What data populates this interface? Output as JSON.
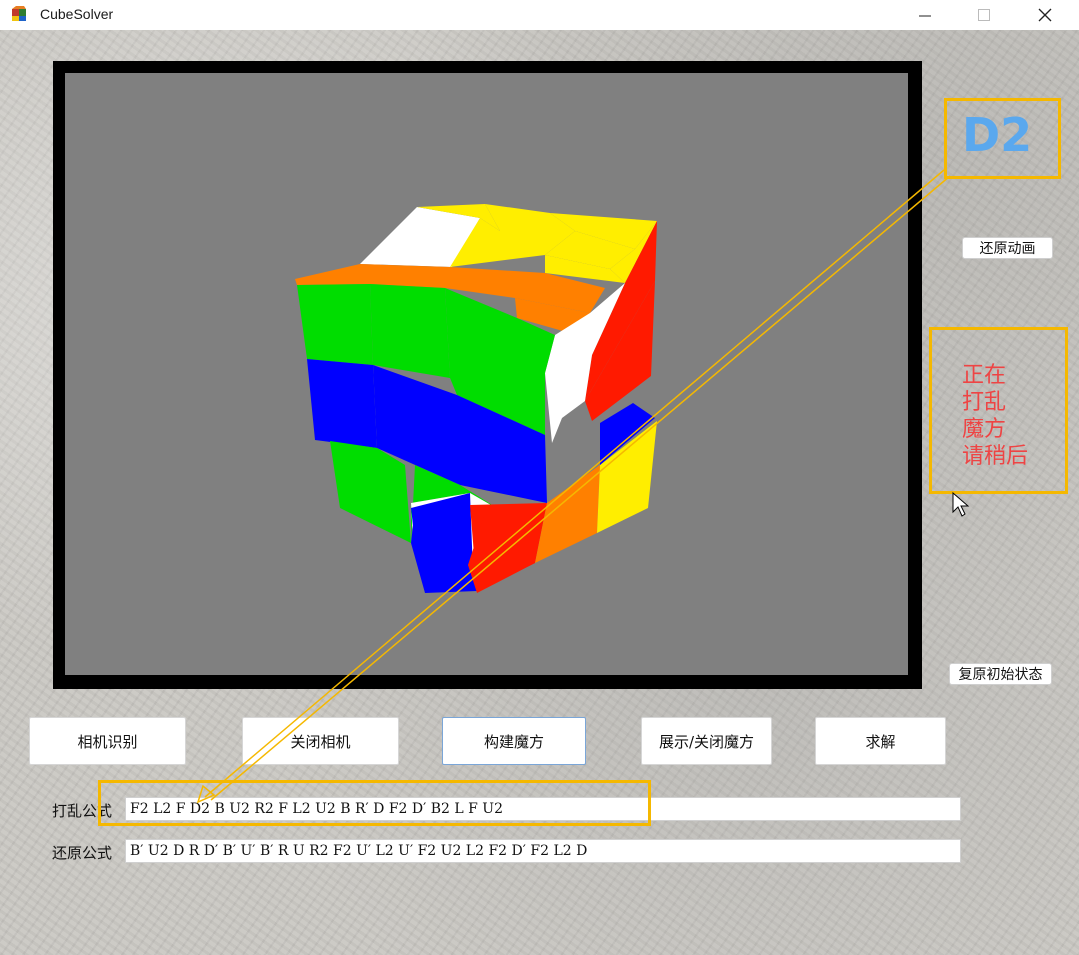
{
  "window": {
    "title": "CubeSolver",
    "controls": [
      "minimize-icon",
      "maximize-icon",
      "close-icon"
    ]
  },
  "side": {
    "current_move": "D2",
    "status_lines": [
      "正在",
      "打乱",
      "魔方",
      "请稍后"
    ],
    "animate_button": "还原动画",
    "reset_button": "复原初始状态"
  },
  "toolbar": {
    "camera_recognize": "相机识别",
    "close_camera": "关闭相机",
    "build_cube": "构建魔方",
    "toggle_cube": "展示/关闭魔方",
    "solve": "求解"
  },
  "formulas": {
    "scramble_label": "打乱公式",
    "scramble_value": "F2 L2 F D2 B U2 R2 F L2 U2 B R′ D F2 D′ B2 L F U2",
    "solve_label": "还原公式",
    "solve_value": "B′ U2 D R D′ B′ U′ B′ R U R2 F2 U′ L2 U′ F2 U2 L2 F2 D′ F2 L2 D"
  },
  "colors": {
    "highlight": "#f5b800",
    "move_text": "#5aa8ee",
    "status_text": "#ee4444",
    "viewport_bg": "#808080"
  }
}
